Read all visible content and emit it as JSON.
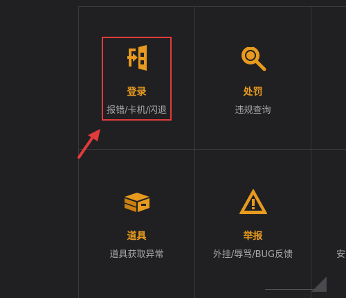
{
  "tiles": [
    {
      "id": "login",
      "title": "登录",
      "subtitle": "报错/卡机/闪退",
      "icon": "door-exit-icon"
    },
    {
      "id": "penalty",
      "title": "处罚",
      "subtitle": "违规查询",
      "icon": "magnifier-icon"
    },
    {
      "id": "items",
      "title": "道具",
      "subtitle": "道具获取异常",
      "icon": "toolbox-icon"
    },
    {
      "id": "report",
      "title": "举报",
      "subtitle": "外挂/辱骂/BUG反馈",
      "icon": "warning-icon"
    }
  ],
  "partial": {
    "row2_col3_subtitle": "安"
  },
  "colors": {
    "accent": "#e89a1e",
    "highlight": "#e23b3b",
    "background": "#202022"
  }
}
